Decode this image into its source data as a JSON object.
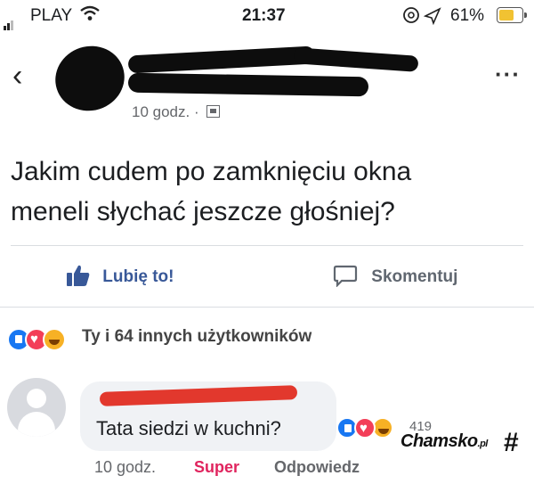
{
  "status_bar": {
    "carrier": "PLAY",
    "time": "21:37",
    "battery": "61%",
    "icons": [
      "signal-icon",
      "wifi-icon",
      "at-icon",
      "location-icon",
      "battery-icon"
    ]
  },
  "post": {
    "time": "10 godz. ·",
    "text_line1": "Jakim cudem po zamknięciu okna",
    "text_line2": "meneli słychać jeszcze głośniej?"
  },
  "actions": {
    "like": "Lubię to!",
    "comment": "Skomentuj"
  },
  "reactions": {
    "summary": "Ty i 64 innych użytkowników",
    "icons": [
      "like-reaction-icon",
      "love-reaction-icon",
      "haha-reaction-icon"
    ]
  },
  "comment": {
    "text": "Tata siedzi w kuchni?",
    "reaction_count": "419",
    "time": "10 godz.",
    "reaction_label": "Super",
    "reply": "Odpowiedz"
  },
  "watermark": {
    "brand": "Chamsko",
    "tld": ".pl"
  },
  "colors": {
    "accent": "#385898",
    "super": "#e0245e",
    "redaction": "#0d0d0d",
    "comment_redaction": "#e2382d"
  }
}
